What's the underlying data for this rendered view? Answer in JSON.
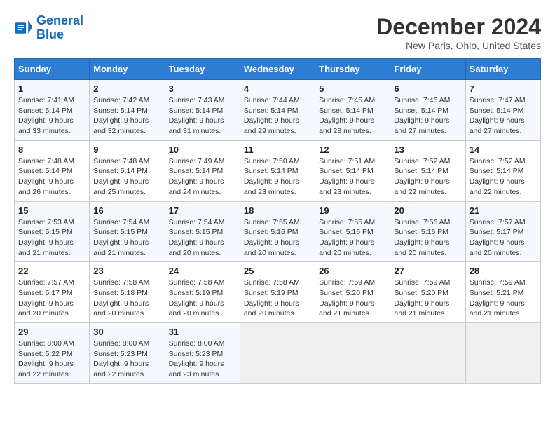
{
  "header": {
    "logo_line1": "General",
    "logo_line2": "Blue",
    "title": "December 2024",
    "subtitle": "New Paris, Ohio, United States"
  },
  "days_of_week": [
    "Sunday",
    "Monday",
    "Tuesday",
    "Wednesday",
    "Thursday",
    "Friday",
    "Saturday"
  ],
  "weeks": [
    [
      {
        "day": "1",
        "info": "Sunrise: 7:41 AM\nSunset: 5:14 PM\nDaylight: 9 hours and 33 minutes."
      },
      {
        "day": "2",
        "info": "Sunrise: 7:42 AM\nSunset: 5:14 PM\nDaylight: 9 hours and 32 minutes."
      },
      {
        "day": "3",
        "info": "Sunrise: 7:43 AM\nSunset: 5:14 PM\nDaylight: 9 hours and 31 minutes."
      },
      {
        "day": "4",
        "info": "Sunrise: 7:44 AM\nSunset: 5:14 PM\nDaylight: 9 hours and 29 minutes."
      },
      {
        "day": "5",
        "info": "Sunrise: 7:45 AM\nSunset: 5:14 PM\nDaylight: 9 hours and 28 minutes."
      },
      {
        "day": "6",
        "info": "Sunrise: 7:46 AM\nSunset: 5:14 PM\nDaylight: 9 hours and 27 minutes."
      },
      {
        "day": "7",
        "info": "Sunrise: 7:47 AM\nSunset: 5:14 PM\nDaylight: 9 hours and 27 minutes."
      }
    ],
    [
      {
        "day": "8",
        "info": "Sunrise: 7:48 AM\nSunset: 5:14 PM\nDaylight: 9 hours and 26 minutes."
      },
      {
        "day": "9",
        "info": "Sunrise: 7:48 AM\nSunset: 5:14 PM\nDaylight: 9 hours and 25 minutes."
      },
      {
        "day": "10",
        "info": "Sunrise: 7:49 AM\nSunset: 5:14 PM\nDaylight: 9 hours and 24 minutes."
      },
      {
        "day": "11",
        "info": "Sunrise: 7:50 AM\nSunset: 5:14 PM\nDaylight: 9 hours and 23 minutes."
      },
      {
        "day": "12",
        "info": "Sunrise: 7:51 AM\nSunset: 5:14 PM\nDaylight: 9 hours and 23 minutes."
      },
      {
        "day": "13",
        "info": "Sunrise: 7:52 AM\nSunset: 5:14 PM\nDaylight: 9 hours and 22 minutes."
      },
      {
        "day": "14",
        "info": "Sunrise: 7:52 AM\nSunset: 5:14 PM\nDaylight: 9 hours and 22 minutes."
      }
    ],
    [
      {
        "day": "15",
        "info": "Sunrise: 7:53 AM\nSunset: 5:15 PM\nDaylight: 9 hours and 21 minutes."
      },
      {
        "day": "16",
        "info": "Sunrise: 7:54 AM\nSunset: 5:15 PM\nDaylight: 9 hours and 21 minutes."
      },
      {
        "day": "17",
        "info": "Sunrise: 7:54 AM\nSunset: 5:15 PM\nDaylight: 9 hours and 20 minutes."
      },
      {
        "day": "18",
        "info": "Sunrise: 7:55 AM\nSunset: 5:16 PM\nDaylight: 9 hours and 20 minutes."
      },
      {
        "day": "19",
        "info": "Sunrise: 7:55 AM\nSunset: 5:16 PM\nDaylight: 9 hours and 20 minutes."
      },
      {
        "day": "20",
        "info": "Sunrise: 7:56 AM\nSunset: 5:16 PM\nDaylight: 9 hours and 20 minutes."
      },
      {
        "day": "21",
        "info": "Sunrise: 7:57 AM\nSunset: 5:17 PM\nDaylight: 9 hours and 20 minutes."
      }
    ],
    [
      {
        "day": "22",
        "info": "Sunrise: 7:57 AM\nSunset: 5:17 PM\nDaylight: 9 hours and 20 minutes."
      },
      {
        "day": "23",
        "info": "Sunrise: 7:58 AM\nSunset: 5:18 PM\nDaylight: 9 hours and 20 minutes."
      },
      {
        "day": "24",
        "info": "Sunrise: 7:58 AM\nSunset: 5:19 PM\nDaylight: 9 hours and 20 minutes."
      },
      {
        "day": "25",
        "info": "Sunrise: 7:58 AM\nSunset: 5:19 PM\nDaylight: 9 hours and 20 minutes."
      },
      {
        "day": "26",
        "info": "Sunrise: 7:59 AM\nSunset: 5:20 PM\nDaylight: 9 hours and 21 minutes."
      },
      {
        "day": "27",
        "info": "Sunrise: 7:59 AM\nSunset: 5:20 PM\nDaylight: 9 hours and 21 minutes."
      },
      {
        "day": "28",
        "info": "Sunrise: 7:59 AM\nSunset: 5:21 PM\nDaylight: 9 hours and 21 minutes."
      }
    ],
    [
      {
        "day": "29",
        "info": "Sunrise: 8:00 AM\nSunset: 5:22 PM\nDaylight: 9 hours and 22 minutes."
      },
      {
        "day": "30",
        "info": "Sunrise: 8:00 AM\nSunset: 5:23 PM\nDaylight: 9 hours and 22 minutes."
      },
      {
        "day": "31",
        "info": "Sunrise: 8:00 AM\nSunset: 5:23 PM\nDaylight: 9 hours and 23 minutes."
      },
      {
        "day": "",
        "info": ""
      },
      {
        "day": "",
        "info": ""
      },
      {
        "day": "",
        "info": ""
      },
      {
        "day": "",
        "info": ""
      }
    ]
  ]
}
